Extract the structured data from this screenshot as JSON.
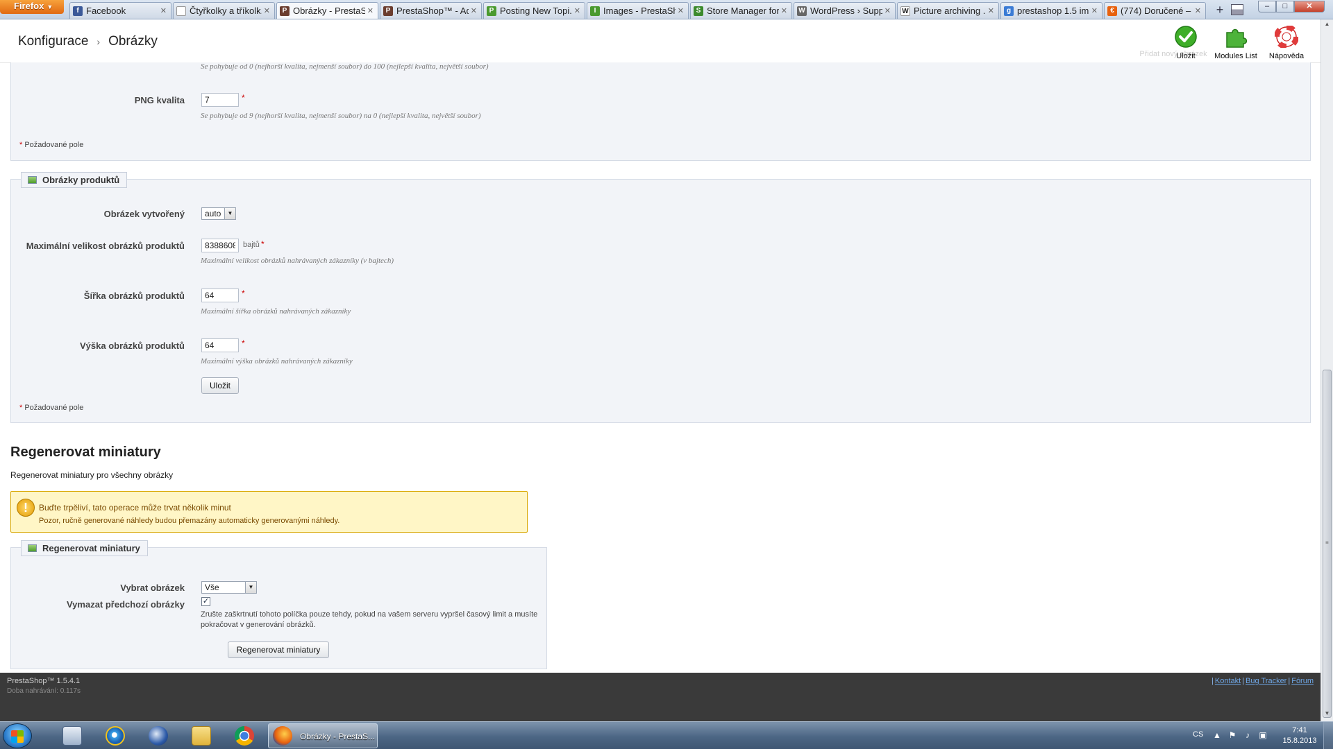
{
  "browser": {
    "menu_label": "Firefox",
    "tabs": [
      {
        "title": "Facebook",
        "active": false,
        "fav_color": "#3b5998",
        "fav_letter": "f"
      },
      {
        "title": "Čtyřkolky a tříkolk...",
        "active": false,
        "fav_color": "#ffffff",
        "fav_letter": ""
      },
      {
        "title": "Obrázky - PrestaS...",
        "active": true,
        "fav_color": "#6b3d2e",
        "fav_letter": "P"
      },
      {
        "title": "PrestaShop™ - Ad...",
        "active": false,
        "fav_color": "#6b3d2e",
        "fav_letter": "P"
      },
      {
        "title": "Posting New Topi...",
        "active": false,
        "fav_color": "#4a9a2f",
        "fav_letter": "P"
      },
      {
        "title": "Images - PrestaSh...",
        "active": false,
        "fav_color": "#4a9a2f",
        "fav_letter": "I"
      },
      {
        "title": "Store Manager for...",
        "active": false,
        "fav_color": "#3c8a2c",
        "fav_letter": "S"
      },
      {
        "title": "WordPress › Supp...",
        "active": false,
        "fav_color": "#666666",
        "fav_letter": "W"
      },
      {
        "title": "Picture archiving ...",
        "active": false,
        "fav_color": "#ffffff",
        "fav_letter": "W"
      },
      {
        "title": "prestashop 1.5 im...",
        "active": false,
        "fav_color": "#3a7bd5",
        "fav_letter": "g"
      },
      {
        "title": "(774) Doručené – ...",
        "active": false,
        "fav_color": "#e8620f",
        "fav_letter": "€"
      }
    ],
    "new_tab": "+",
    "win_min": "–",
    "win_max": "□",
    "win_close": "✕"
  },
  "header": {
    "breadcrumb": [
      "Konfigurace",
      "Obrázky"
    ],
    "breadcrumb_sep": "›",
    "toolbar": {
      "add_new": "Přidat nový obrázek",
      "save": "Uložit",
      "modules": "Modules List",
      "help": "Nápověda"
    }
  },
  "top_section": {
    "jpeg_hint": "Se pohybuje od 0 (nejhorší kvalita, nejmenší soubor) do 100 (nejlepší kvalita, největší soubor)",
    "png_label": "PNG kvalita",
    "png_value": "7",
    "png_hint": "Se pohybuje od 9 (nejhorší kvalita, nejmenší soubor) na 0 (nejlepší kvalita, největší soubor)",
    "required_note": "Požadované pole"
  },
  "product_images": {
    "legend": "Obrázky produktů",
    "created_label": "Obrázek vytvořený",
    "created_value": "auto",
    "max_size_label": "Maximální velikost obrázků produktů",
    "max_size_value": "8388608",
    "max_size_unit": "bajtů",
    "max_size_hint": "Maximální velikost obrázků nahrávaných zákazníky (v bajtech)",
    "width_label": "Šířka obrázků produktů",
    "width_value": "64",
    "width_hint": "Maximální šířka obrázků nahrávaných zákazníky",
    "height_label": "Výška obrázků produktů",
    "height_value": "64",
    "height_hint": "Maximální výška obrázků nahrávaných zákazníky",
    "save_button": "Uložit",
    "required_note": "Požadované pole"
  },
  "regenerate": {
    "title": "Regenerovat miniatury",
    "subtitle": "Regenerovat miniatury pro všechny obrázky",
    "warning_line1": "Buďte trpěliví, tato operace může trvat několik minut",
    "warning_line2": "Pozor, ručně generované náhledy budou přemazány automaticky generovanými náhledy.",
    "legend": "Regenerovat miniatury",
    "select_label": "Vybrat obrázek",
    "select_value": "Vše",
    "erase_label": "Vymazat předchozí obrázky",
    "erase_checked": "✓",
    "erase_hint": "Zrušte zaškrtnutí tohoto políčka pouze tehdy, pokud na vašem serveru vypršel časový limit a musíte pokračovat v generování obrázků.",
    "button": "Regenerovat miniatury"
  },
  "footer": {
    "version": "PrestaShop™ 1.5.4.1",
    "load_time": "Doba nahrávání: 0.117s",
    "links": [
      "Kontakt",
      "Bug Tracker",
      "Fórum"
    ]
  },
  "taskbar": {
    "task_title": "Obrázky - PrestaS...",
    "language": "CS",
    "time": "7:41",
    "date": "15.8.2013"
  }
}
